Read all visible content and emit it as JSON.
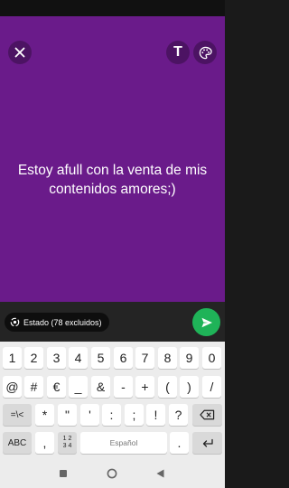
{
  "toolbar": {
    "text_tool_label": "T"
  },
  "status": {
    "message": "Estoy afull con la venta de mis contenidos amores;)"
  },
  "audience": {
    "label": "Estado (78 excluidos)"
  },
  "keyboard": {
    "row1": [
      "1",
      "2",
      "3",
      "4",
      "5",
      "6",
      "7",
      "8",
      "9",
      "0"
    ],
    "row2": [
      "@",
      "#",
      "€",
      "_",
      "&",
      "-",
      "+",
      "(",
      ")",
      "/"
    ],
    "row3_mode": "=\\<",
    "row3": [
      "*",
      "\"",
      "'",
      ":",
      ";",
      "!",
      "?"
    ],
    "row4_abc": "ABC",
    "row4_comma": ",",
    "row4_numpad_top": "1 2",
    "row4_numpad_bottom": "3 4",
    "row4_space": "Español",
    "row4_period": "."
  },
  "colors": {
    "status_background": "#6a1b8a",
    "send_button": "#1fb358"
  }
}
